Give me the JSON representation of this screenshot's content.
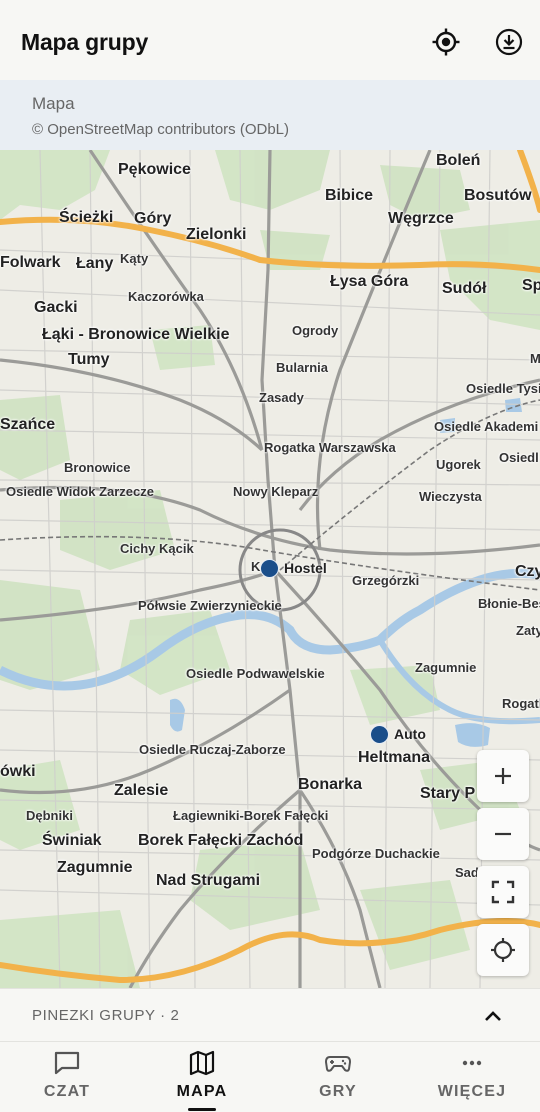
{
  "header": {
    "title": "Mapa grupy",
    "icons": [
      "my-location-icon",
      "download-icon"
    ]
  },
  "info": {
    "title": "Mapa",
    "attribution": "© OpenStreetMap contributors (ODbL)"
  },
  "map": {
    "places": [
      "Boleń",
      "Pękowice",
      "Bibice",
      "Bosutów",
      "Ścieżki",
      "Góry",
      "Węgrzce",
      "Zielonki",
      "Folwark",
      "Łany",
      "Kąty",
      "Łysa Góra",
      "Sudół",
      "Sp",
      "Gacki",
      "Kaczorówka",
      "Łąki - Bronowice Wielkie",
      "Ogrody",
      "Tumy",
      "Bularnia",
      "M",
      "Osiedle Tysi",
      "Zasady",
      "Szańce",
      "Osiedle Akademi",
      "Rogatka Warszawska",
      "Osiedl",
      "Ugorek",
      "Bronowice",
      "Osiedle Widok Zarzecze",
      "Nowy Kleparz",
      "Wieczysta",
      "Cichy Kącik",
      "Grzegórzki",
      "Czy",
      "Półwsie Zwierzynieckie",
      "Błonie-Bes",
      "Zaty",
      "Zagumnie",
      "Osiedle Podwawelskie",
      "Rogatl",
      "Osiedle Ruczaj-Zaborze",
      "Heltmana",
      "ówki",
      "Zalesie",
      "Bonarka",
      "Stary P",
      "Dębniki",
      "Łagiewniki-Borek Fałęcki",
      "Świniak",
      "Borek Fałęcki Zachód",
      "Podgórze Duchackie",
      "Zagumnie",
      "Sad",
      "Nad Strugami"
    ],
    "pins": [
      {
        "label": "Kraków Hostel",
        "visible_text": "Hostel",
        "prefix": "K"
      },
      {
        "label": "Auto"
      }
    ],
    "controls": {
      "zoom_in": "+",
      "zoom_out": "−",
      "fullscreen": "fullscreen-icon",
      "locate": "locate-icon"
    },
    "colors": {
      "pin": "#1a4e8a",
      "highway": "#f2b24a",
      "river": "#a8c9e6",
      "green": "#cfe3c2"
    }
  },
  "pinsbar": {
    "label": "PINEZKI GRUPY · 2"
  },
  "nav": {
    "items": [
      {
        "label": "CZAT",
        "icon": "chat-icon"
      },
      {
        "label": "MAPA",
        "icon": "map-icon",
        "active": true
      },
      {
        "label": "GRY",
        "icon": "gamepad-icon"
      },
      {
        "label": "WIĘCEJ",
        "icon": "more-icon"
      }
    ]
  }
}
